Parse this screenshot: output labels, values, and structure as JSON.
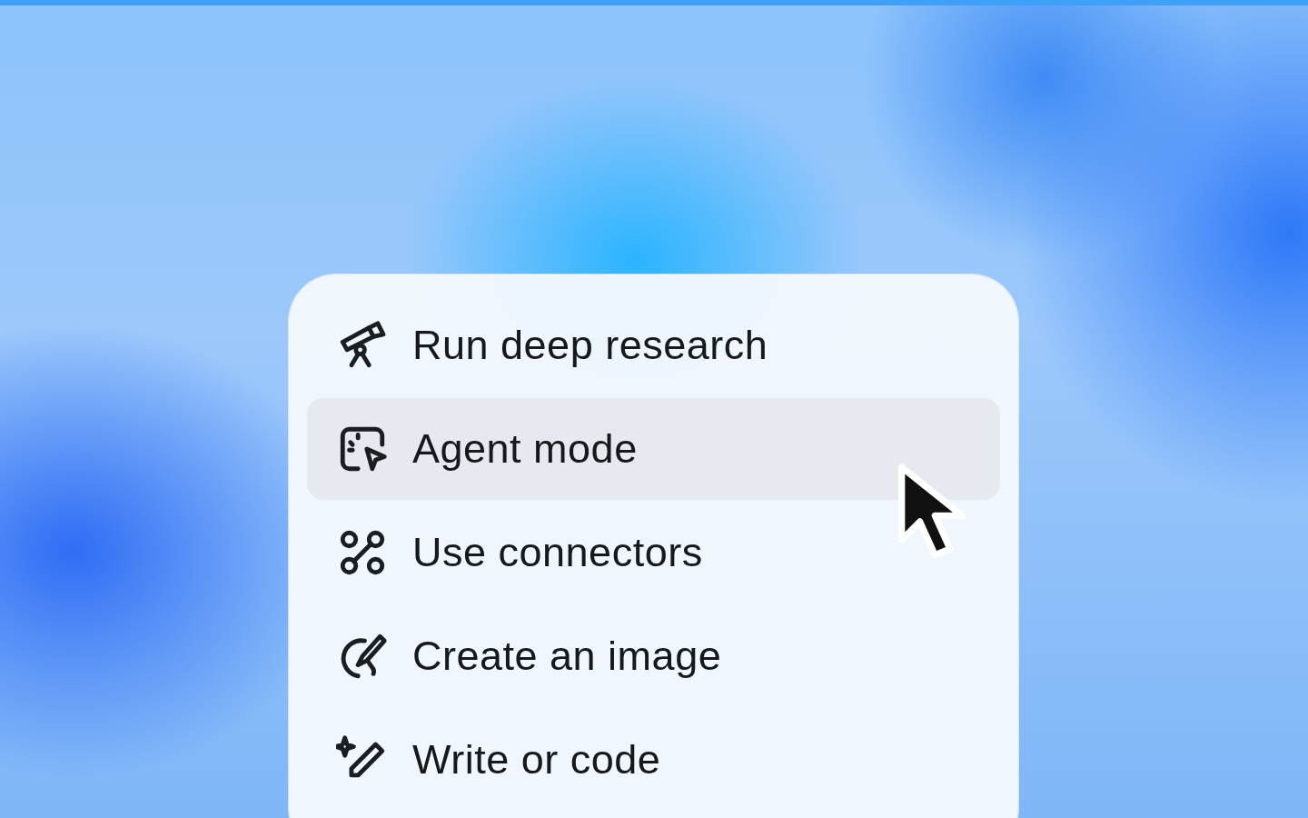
{
  "menu": {
    "items": [
      {
        "label": "Run deep research",
        "kind": "research",
        "selected": false
      },
      {
        "label": "Agent mode",
        "kind": "agent",
        "selected": true
      },
      {
        "label": "Use connectors",
        "kind": "connectors",
        "selected": false
      },
      {
        "label": "Create an image",
        "kind": "image",
        "selected": false
      },
      {
        "label": "Write or code",
        "kind": "write",
        "selected": false
      }
    ]
  }
}
